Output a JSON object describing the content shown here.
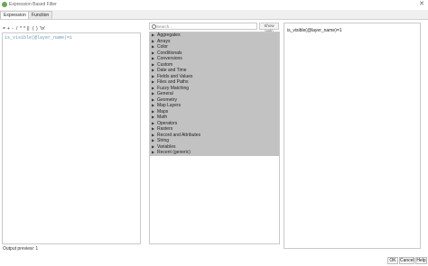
{
  "window": {
    "title": "Expression Based Filter",
    "close": "✕"
  },
  "tabs": [
    {
      "label": "Expression",
      "active": true
    },
    {
      "label": "Function Editor",
      "active": false
    }
  ],
  "toolbar": {
    "items": [
      "=",
      "+",
      "-",
      "/",
      "*",
      "^",
      "||",
      "(",
      ")",
      "'\\n'"
    ]
  },
  "editor": {
    "text": "is_visible(@layer_name)=1"
  },
  "output_preview": "Output preview: 1",
  "search": {
    "placeholder": "Search...",
    "show_help_label": "Show Help"
  },
  "function_groups": [
    "Aggregates",
    "Arrays",
    "Color",
    "Conditionals",
    "Conversions",
    "Custom",
    "Date and Time",
    "Fields and Values",
    "Files and Paths",
    "Fuzzy Matching",
    "General",
    "Geometry",
    "Map Layers",
    "Maps",
    "Math",
    "Operators",
    "Rasters",
    "Record and Attributes",
    "String",
    "Variables",
    "Recent (generic)"
  ],
  "help_panel": {
    "text": "is_visible(@layer_name)=1"
  },
  "buttons": {
    "ok": "OK",
    "cancel": "Cancel",
    "help": "Help"
  },
  "colors": {
    "list_highlight": "#c2c2c2",
    "editor_text": "#6a9ab8"
  }
}
